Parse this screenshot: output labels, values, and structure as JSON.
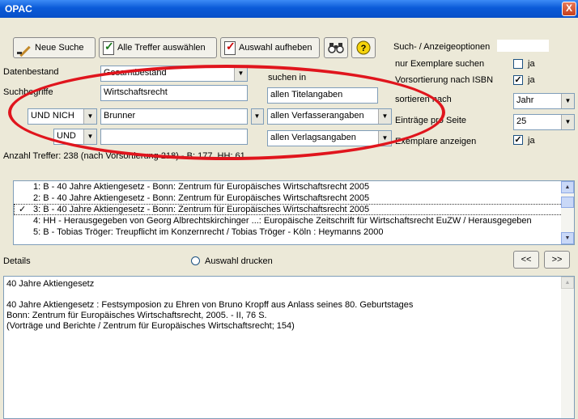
{
  "window": {
    "title": "OPAC",
    "close": "X"
  },
  "toolbar": {
    "new_search": "Neue Suche",
    "select_all": "Alle Treffer auswählen",
    "deselect": "Auswahl aufheben",
    "options_title": "Such- / Anzeigeoptionen"
  },
  "form": {
    "datenbestand_label": "Datenbestand",
    "datenbestand_value": "Gesamtbestand",
    "suchbegriffe_label": "Suchbegriffe",
    "suchen_in_label": "suchen in",
    "rows": [
      {
        "op": "",
        "term": "Wirtschaftsrecht",
        "field": "allen Titelangaben"
      },
      {
        "op": "UND NICH",
        "term": "Brunner",
        "field": "allen Verfasserangaben"
      },
      {
        "op": "UND",
        "term": "",
        "field": "allen Verlagsangaben"
      }
    ],
    "hits": "Anzahl Treffer: 238 (nach Vorsortierung 218) - B: 177, HH: 61"
  },
  "options": {
    "only_copies": "nur Exemplare suchen",
    "presort_isbn": "Vorsortierung nach ISBN",
    "sort_by": "sortieren nach",
    "per_page": "Einträge pro Seite",
    "show_copies": "Exemplare anzeigen",
    "ja": "ja",
    "check_mark": "✓",
    "sort_value": "Jahr",
    "per_page_value": "25"
  },
  "results": [
    {
      "text": "1: B - 40 Jahre Aktiengesetz - Bonn: Zentrum für Europäisches Wirtschaftsrecht 2005",
      "mark": ""
    },
    {
      "text": "2: B - 40 Jahre Aktiengesetz - Bonn: Zentrum für Europäisches Wirtschaftsrecht 2005",
      "mark": ""
    },
    {
      "text": "3: B - 40 Jahre Aktiengesetz - Bonn: Zentrum für Europäisches Wirtschaftsrecht 2005",
      "mark": "✓"
    },
    {
      "text": "4: HH - Herausgegeben von Georg Albrechtskirchinger ...: Europäische Zeitschrift für Wirtschaftsrecht EuZW / Herausgegeben",
      "mark": ""
    },
    {
      "text": "5: B - Tobias Tröger: Treupflicht im Konzernrecht / Tobias Tröger - Köln : Heymanns 2000",
      "mark": ""
    }
  ],
  "details": {
    "label": "Details",
    "print_label": "Auswahl drucken",
    "prev": "<<",
    "next": ">>",
    "lines": [
      "40 Jahre Aktiengesetz",
      "",
      "40 Jahre Aktiengesetz : Festsymposion zu Ehren von Bruno Kropff aus Anlass seines 80. Geburtstages",
      "Bonn: Zentrum für Europäisches Wirtschaftsrecht, 2005. - II, 76 S.",
      "(Vorträge und Berichte / Zentrum für Europäisches Wirtschaftsrecht; 154)"
    ]
  },
  "colors": {
    "titlebar": "#0a5ad8",
    "highlight_ellipse": "#e0151d"
  }
}
